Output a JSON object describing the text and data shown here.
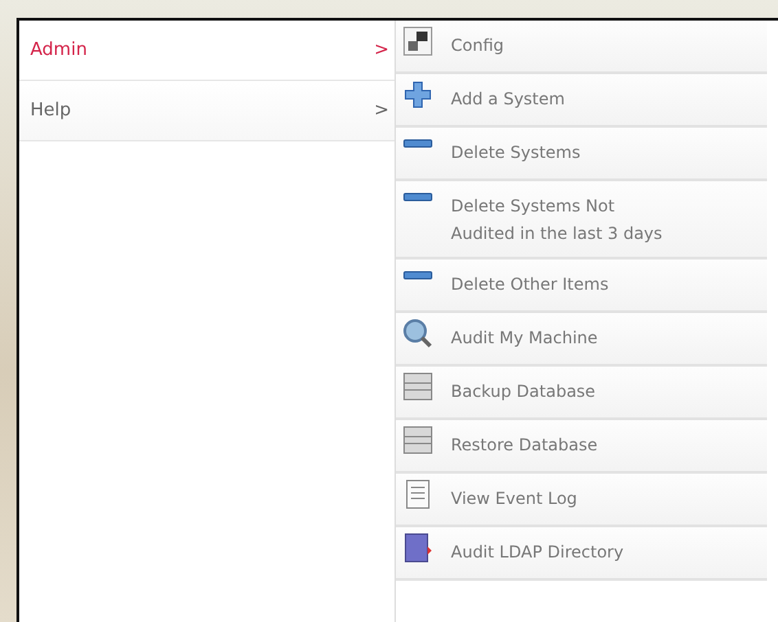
{
  "menu": {
    "items": [
      {
        "label": "Admin",
        "arrow": ">",
        "selected": true
      },
      {
        "label": "Help",
        "arrow": ">",
        "selected": false
      }
    ]
  },
  "submenu": {
    "items": [
      {
        "label": "Config",
        "kind": "config"
      },
      {
        "label": "Add a System",
        "kind": "add"
      },
      {
        "label": "Delete Systems",
        "kind": "remove"
      },
      {
        "label": "Delete Systems Not Audited in the last 3 days",
        "kind": "remove"
      },
      {
        "label": "Delete Other Items",
        "kind": "remove"
      },
      {
        "label": "Audit My Machine",
        "kind": "audit"
      },
      {
        "label": "Backup Database",
        "kind": "backup"
      },
      {
        "label": "Restore Database",
        "kind": "backup"
      },
      {
        "label": "View Event Log",
        "kind": "log"
      },
      {
        "label": "Audit LDAP Directory",
        "kind": "directory"
      }
    ]
  }
}
